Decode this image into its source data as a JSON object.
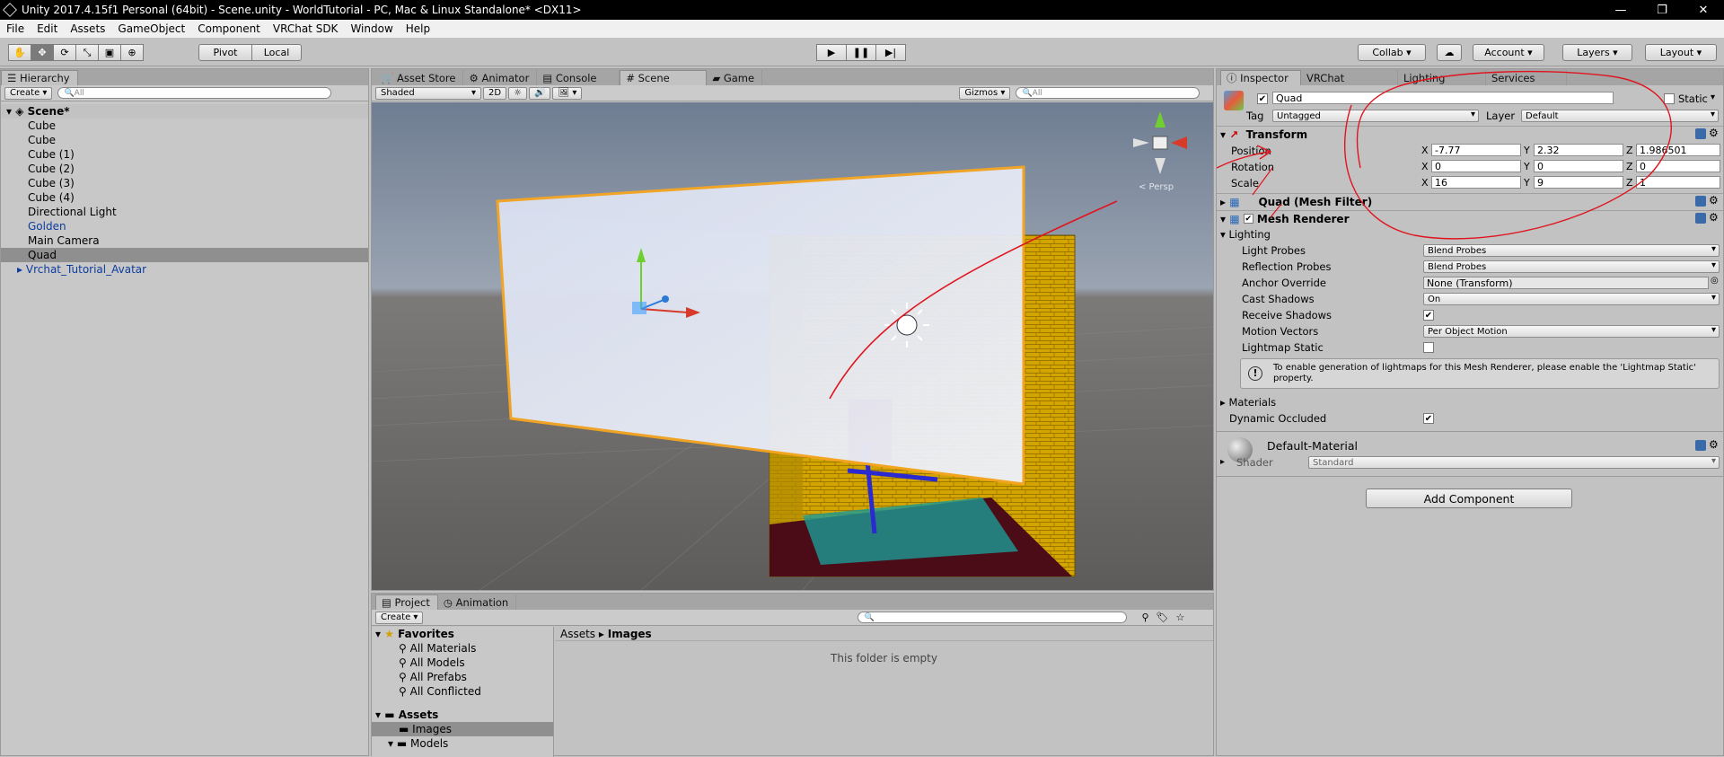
{
  "window": {
    "title": "Unity 2017.4.15f1 Personal (64bit) - Scene.unity - WorldTutorial - PC, Mac & Linux Standalone* <DX11>",
    "minimize": "—",
    "maximize": "❐",
    "close": "✕"
  },
  "menu": [
    "File",
    "Edit",
    "Assets",
    "GameObject",
    "Component",
    "VRChat SDK",
    "Window",
    "Help"
  ],
  "toolbar": {
    "pivot": "Pivot",
    "local": "Local",
    "collab": "Collab ▾",
    "account": "Account",
    "layers": "Layers",
    "layout": "Layout"
  },
  "hierarchy": {
    "tab": "Hierarchy",
    "create": "Create",
    "search_placeholder": "All",
    "scene": "Scene*",
    "items": [
      "Cube",
      "Cube",
      "Cube (1)",
      "Cube (2)",
      "Cube (3)",
      "Cube (4)",
      "Directional Light",
      "Golden",
      "Main Camera",
      "Quad",
      "Vrchat_Tutorial_Avatar"
    ]
  },
  "scene_view": {
    "tabs": [
      "Asset Store",
      "Animator",
      "Console",
      "Scene",
      "Game"
    ],
    "shading": "Shaded",
    "mode_2d": "2D",
    "gizmos": "Gizmos",
    "search_placeholder": "All",
    "persp": "< Persp"
  },
  "project": {
    "tabs": [
      "Project",
      "Animation"
    ],
    "create": "Create",
    "favorites": "Favorites",
    "favorite_items": [
      "All Materials",
      "All Models",
      "All Prefabs",
      "All Conflicted"
    ],
    "assets": "Assets",
    "asset_folders": [
      "Images",
      "Models"
    ],
    "breadcrumb_root": "Assets",
    "breadcrumb_sep": "▸",
    "breadcrumb_current": "Images",
    "empty_text": "This folder is empty"
  },
  "inspector": {
    "tabs": [
      "Inspector",
      "VRChat",
      "Lighting",
      "Services"
    ],
    "object_name": "Quad",
    "static_label": "Static",
    "tag_label": "Tag",
    "tag_value": "Untagged",
    "layer_label": "Layer",
    "layer_value": "Default",
    "transform": {
      "title": "Transform",
      "position_label": "Position",
      "rotation_label": "Rotation",
      "scale_label": "Scale",
      "axis_x": "X",
      "axis_y": "Y",
      "axis_z": "Z",
      "position": [
        "-7.77",
        "2.32",
        "1.986501"
      ],
      "rotation": [
        "0",
        "0",
        "0"
      ],
      "scale": [
        "16",
        "9",
        "1"
      ]
    },
    "mesh_filter_title": "Quad (Mesh Filter)",
    "mesh_renderer": {
      "title": "Mesh Renderer",
      "lighting": "Lighting",
      "light_probes_label": "Light Probes",
      "light_probes_value": "Blend Probes",
      "reflection_probes_label": "Reflection Probes",
      "reflection_probes_value": "Blend Probes",
      "anchor_override_label": "Anchor Override",
      "anchor_override_value": "None (Transform)",
      "cast_shadows_label": "Cast Shadows",
      "cast_shadows_value": "On",
      "receive_shadows_label": "Receive Shadows",
      "motion_vectors_label": "Motion Vectors",
      "motion_vectors_value": "Per Object Motion",
      "lightmap_static_label": "Lightmap Static",
      "help_text": "To enable generation of lightmaps for this Mesh Renderer, please enable the 'Lightmap Static' property.",
      "materials_label": "Materials",
      "dynamic_occluded_label": "Dynamic Occluded"
    },
    "material": {
      "name": "Default-Material",
      "shader_label": "Shader",
      "shader_value": "Standard"
    },
    "add_component": "Add Component"
  },
  "colors": {
    "annotation": "#e0141e",
    "selection_orange": "#f5a623",
    "brick": "#d4a400"
  }
}
